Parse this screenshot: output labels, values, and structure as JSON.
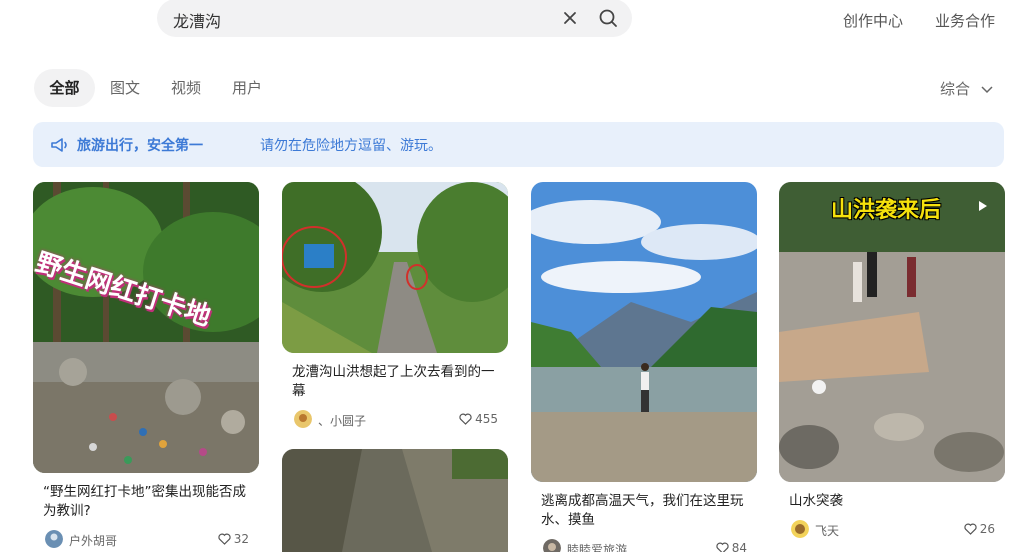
{
  "search": {
    "query": "龙漕沟"
  },
  "header": {
    "create_center": "创作中心",
    "business": "业务合作"
  },
  "tabs": [
    {
      "label": "全部"
    },
    {
      "label": "图文"
    },
    {
      "label": "视频"
    },
    {
      "label": "用户"
    }
  ],
  "sort": {
    "label": "综合"
  },
  "notice": {
    "strong": "旅游出行，安全第一",
    "text": "请勿在危险地方逗留、游玩。"
  },
  "cards": [
    {
      "overlay": "野生网红打卡地",
      "title": "“野生网红打卡地”密集出现能否成为教训?",
      "author": "户外胡哥",
      "likes": "32"
    },
    {
      "overlay": "",
      "title": "龙漕沟山洪想起了上次去看到的一幕",
      "author": "、小圆子",
      "likes": "455"
    },
    {
      "overlay": "",
      "title": "逃离成都高温天气，我们在这里玩水、摸鱼",
      "author": "睦睦爱旅游",
      "likes": "84"
    },
    {
      "overlay": "山洪袭来后",
      "title": "山水突袭",
      "author": "飞天",
      "likes": "26"
    }
  ],
  "colors": {
    "accent": "#3d7ad6",
    "notice_bg": "#e8f0fb",
    "pill_bg": "#f2f2f3"
  }
}
